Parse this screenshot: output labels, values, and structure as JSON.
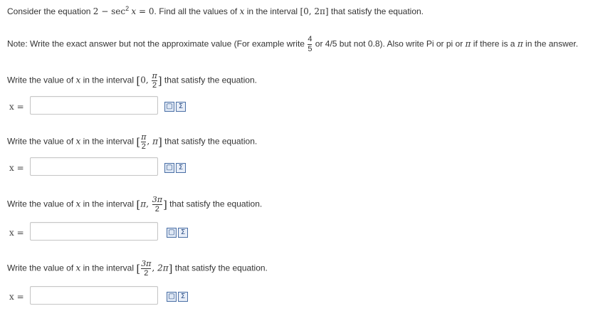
{
  "intro": {
    "prefix": "Consider the equation ",
    "equation_const": "2 − sec",
    "equation_exp": "2",
    "equation_var": "x",
    "equation_rhs": " = 0",
    "middle": ". Find all the values of ",
    "var": "x",
    "interval_text": " in the interval ",
    "interval": "[0, 2π]",
    "suffix": " that satisfy the equation."
  },
  "note": {
    "part1": "Note: Write the exact answer but not the approximate value (For example write ",
    "frac_num": "4",
    "frac_den": "5",
    "part2": " or 4/5 but not 0.8). Also write Pi or pi or ",
    "pi": "π",
    "part3": " if there is a ",
    "part4": " in the answer."
  },
  "questions": [
    {
      "lead": "Write the value of ",
      "var": "x",
      "mid": " in the interval ",
      "left_bracket": "[",
      "lower": "0",
      "upper_num": "π",
      "upper_den": "2",
      "right_bracket": "]",
      "tail": " that satisfy the equation.",
      "label": "x =",
      "value": ""
    },
    {
      "lead": "Write the value of ",
      "var": "x",
      "mid": " in the interval ",
      "left_bracket": "[",
      "lower_num": "π",
      "lower_den": "2",
      "upper": "π",
      "right_bracket": "]",
      "tail": " that satisfy the equation.",
      "label": "x =",
      "value": ""
    },
    {
      "lead": "Write the value of ",
      "var": "x",
      "mid": " in the interval ",
      "left_bracket": "[",
      "lower": "π",
      "upper_num": "3π",
      "upper_den": "2",
      "right_bracket": "]",
      "tail": " that satisfy the equation.",
      "label": "x =",
      "value": ""
    },
    {
      "lead": "Write the value of ",
      "var": "x",
      "mid": " in the interval ",
      "left_bracket": "[",
      "lower_num": "3π",
      "lower_den": "2",
      "upper": "2π",
      "right_bracket": "]",
      "tail": " that satisfy the equation.",
      "label": "x =",
      "value": ""
    }
  ],
  "icons": {
    "preview": "preview-icon",
    "equation_editor": "equation-editor-icon"
  }
}
